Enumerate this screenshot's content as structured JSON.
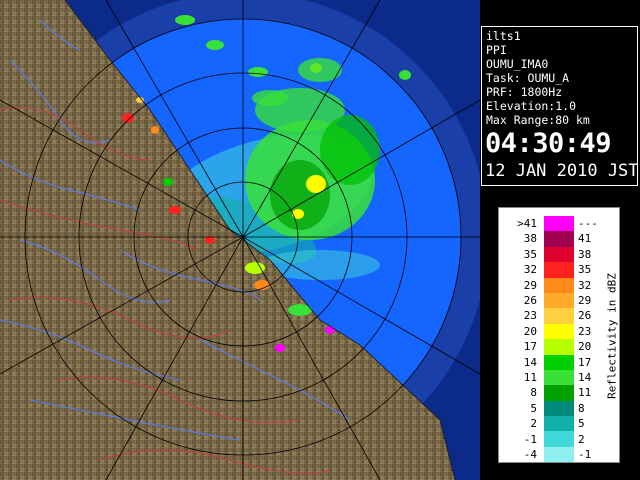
{
  "info": {
    "site": "ilts1",
    "product": "PPI",
    "volume": "OUMU_IMA0",
    "task": "Task: OUMU_A",
    "prf": "PRF: 1800Hz",
    "elevation": "Elevation:1.0",
    "max_range": "Max Range:80 km",
    "time": "04:30:49",
    "date": "12 JAN 2010 JST"
  },
  "legend": {
    "unit": "Reflectivity in dBZ",
    "rows": [
      {
        "low": ">41",
        "high": "---",
        "color": "#ff00ff"
      },
      {
        "low": "38",
        "high": "41",
        "color": "#a00050"
      },
      {
        "low": "35",
        "high": "38",
        "color": "#e00030"
      },
      {
        "low": "32",
        "high": "35",
        "color": "#ff2020"
      },
      {
        "low": "29",
        "high": "32",
        "color": "#ff8a1a"
      },
      {
        "low": "26",
        "high": "29",
        "color": "#ffaa28"
      },
      {
        "low": "23",
        "high": "26",
        "color": "#ffd040"
      },
      {
        "low": "20",
        "high": "23",
        "color": "#ffff00"
      },
      {
        "low": "17",
        "high": "20",
        "color": "#b8ff00"
      },
      {
        "low": "14",
        "high": "17",
        "color": "#00d000"
      },
      {
        "low": "11",
        "high": "14",
        "color": "#38e038"
      },
      {
        "low": "8",
        "high": "11",
        "color": "#00a000"
      },
      {
        "low": "5",
        "high": "8",
        "color": "#00887a"
      },
      {
        "low": "2",
        "high": "5",
        "color": "#10b0a8"
      },
      {
        "low": "-1",
        "high": "2",
        "color": "#40d8d8"
      },
      {
        "low": "-4",
        "high": "-1",
        "color": "#90f0f0"
      }
    ]
  },
  "map": {
    "radar_center": "radar-site",
    "range_ring_color": "#000000",
    "land_color": "#7a6a4a",
    "coverage_color": "#1565ff",
    "outer_coverage_color": "#1a3fa8",
    "coast_line_color": "#222222",
    "river_color": "#5a7aff",
    "boundary_color": "#c04040"
  }
}
